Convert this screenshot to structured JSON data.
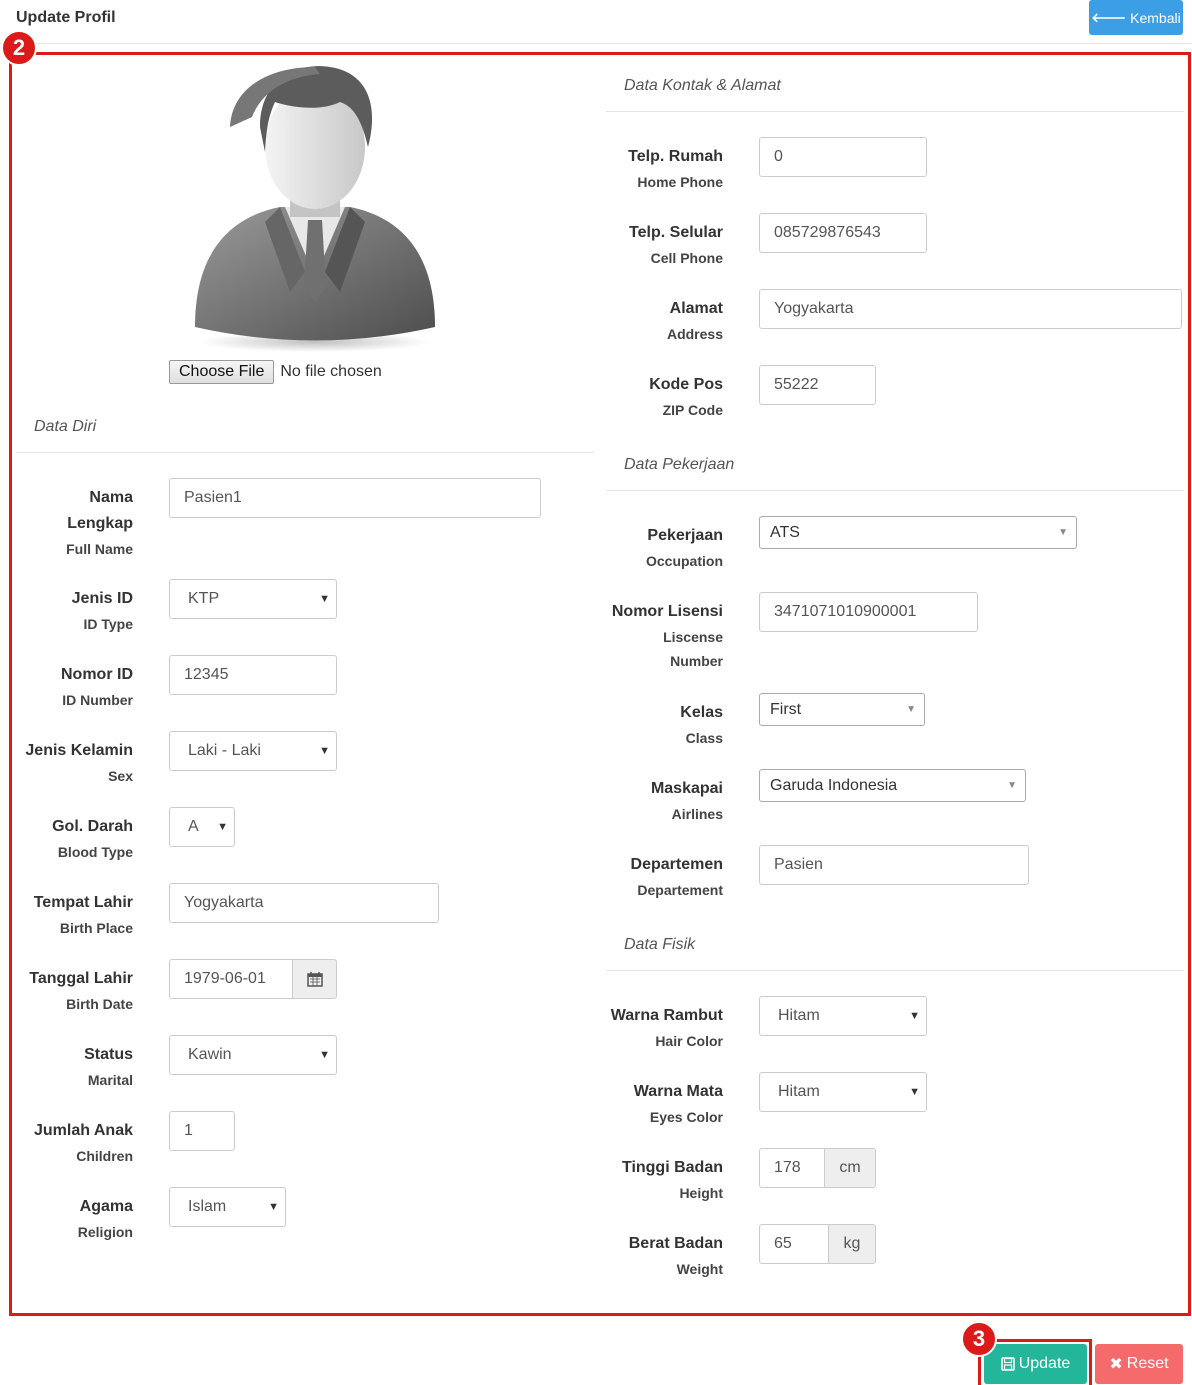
{
  "header": {
    "title": "Update Profil",
    "back_label": "Kembali"
  },
  "annotations": {
    "step_form": "2",
    "step_update": "3"
  },
  "photo": {
    "choose_label": "Choose File",
    "no_file_label": "No file chosen"
  },
  "data_diri": {
    "title": "Data Diri",
    "nama": {
      "label": "Nama",
      "label2": "Lengkap",
      "sub": "Full Name",
      "value": "Pasien1"
    },
    "jenis_id": {
      "label": "Jenis ID",
      "sub": "ID Type",
      "value": "KTP"
    },
    "nomor_id": {
      "label": "Nomor ID",
      "sub": "ID Number",
      "value": "12345"
    },
    "jenis_kelamin": {
      "label": "Jenis Kelamin",
      "sub": "Sex",
      "value": "Laki - Laki"
    },
    "gol_darah": {
      "label": "Gol. Darah",
      "sub": "Blood Type",
      "value": "A"
    },
    "tempat_lahir": {
      "label": "Tempat Lahir",
      "sub": "Birth Place",
      "value": "Yogyakarta"
    },
    "tanggal_lahir": {
      "label": "Tanggal Lahir",
      "sub": "Birth Date",
      "value": "1979-06-01"
    },
    "status": {
      "label": "Status",
      "sub": "Marital",
      "value": "Kawin"
    },
    "jumlah_anak": {
      "label": "Jumlah Anak",
      "sub": "Children",
      "value": "1"
    },
    "agama": {
      "label": "Agama",
      "sub": "Religion",
      "value": "Islam"
    }
  },
  "kontak": {
    "title": "Data Kontak & Alamat",
    "telp_rumah": {
      "label": "Telp. Rumah",
      "sub": "Home Phone",
      "value": "0"
    },
    "telp_selular": {
      "label": "Telp. Selular",
      "sub": "Cell Phone",
      "value": "085729876543"
    },
    "alamat": {
      "label": "Alamat",
      "sub": "Address",
      "value": "Yogyakarta"
    },
    "kode_pos": {
      "label": "Kode Pos",
      "sub": "ZIP Code",
      "value": "55222"
    }
  },
  "pekerjaan": {
    "title": "Data Pekerjaan",
    "pekerjaan": {
      "label": "Pekerjaan",
      "sub": "Occupation",
      "value": "ATS"
    },
    "nomor_lisensi": {
      "label": "Nomor Lisensi",
      "sub": "Liscense",
      "sub2": "Number",
      "value": "3471071010900001"
    },
    "kelas": {
      "label": "Kelas",
      "sub": "Class",
      "value": "First"
    },
    "maskapai": {
      "label": "Maskapai",
      "sub": "Airlines",
      "value": "Garuda Indonesia"
    },
    "departemen": {
      "label": "Departemen",
      "sub": "Departement",
      "value": "Pasien"
    }
  },
  "fisik": {
    "title": "Data Fisik",
    "warna_rambut": {
      "label": "Warna Rambut",
      "sub": "Hair Color",
      "value": "Hitam"
    },
    "warna_mata": {
      "label": "Warna Mata",
      "sub": "Eyes Color",
      "value": "Hitam"
    },
    "tinggi": {
      "label": "Tinggi Badan",
      "sub": "Height",
      "value": "178",
      "unit": "cm"
    },
    "berat": {
      "label": "Berat Badan",
      "sub": "Weight",
      "value": "65",
      "unit": "kg"
    }
  },
  "actions": {
    "update_label": "Update",
    "reset_label": "Reset"
  },
  "colors": {
    "primary": "#3c9ee5",
    "success": "#24b69a",
    "danger": "#f56a6a",
    "annotation": "#dd1a1a"
  }
}
